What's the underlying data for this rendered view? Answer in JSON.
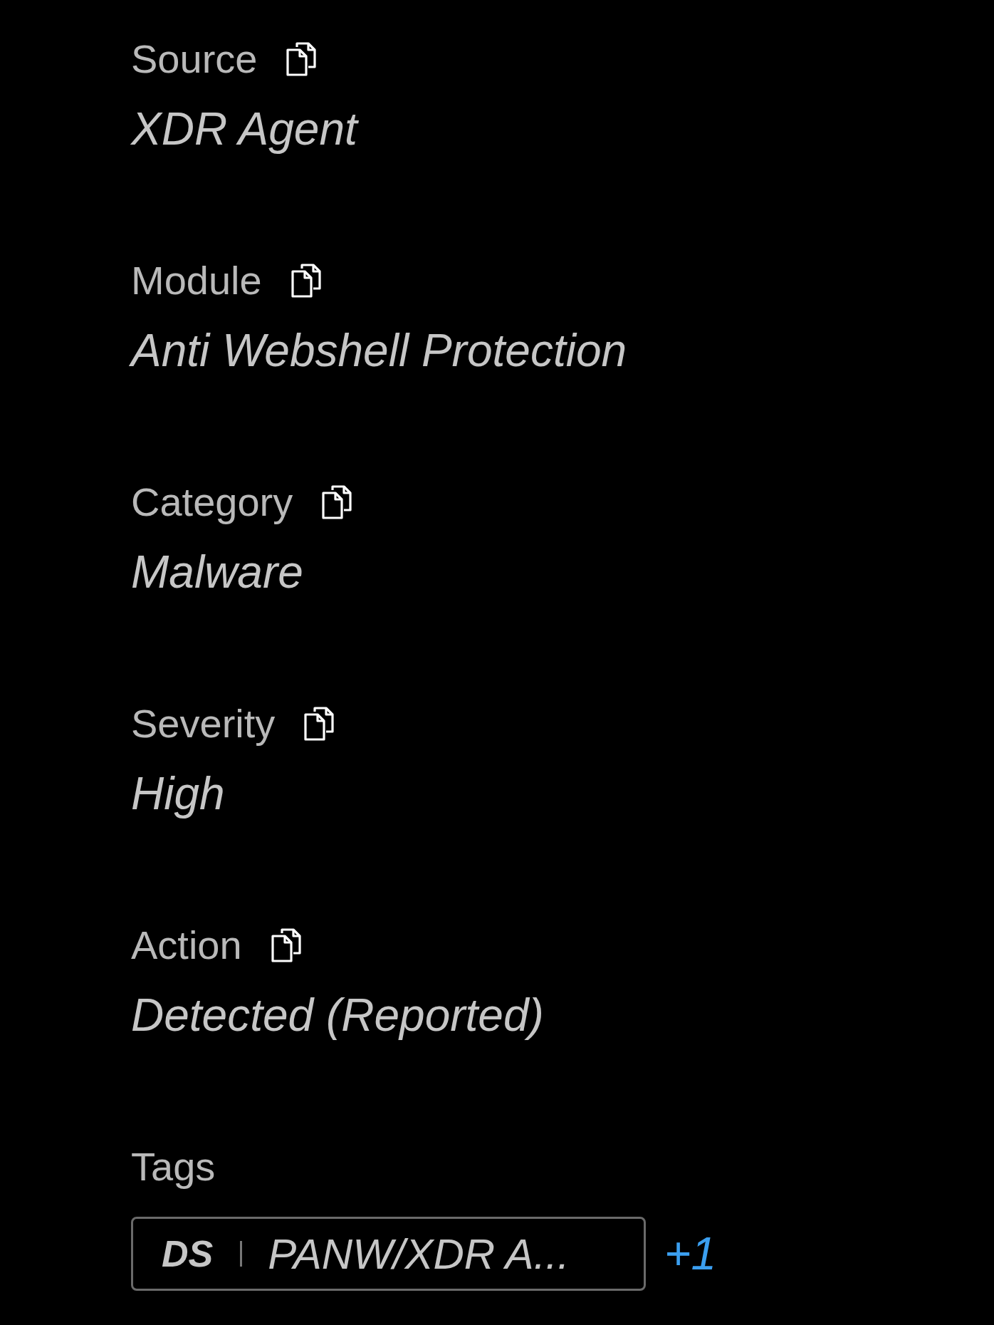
{
  "fields": [
    {
      "label": "Source",
      "value": "XDR Agent"
    },
    {
      "label": "Module",
      "value": "Anti Webshell Protection"
    },
    {
      "label": "Category",
      "value": "Malware"
    },
    {
      "label": "Severity",
      "value": "High"
    },
    {
      "label": "Action",
      "value": "Detected (Reported)"
    }
  ],
  "tags": {
    "label": "Tags",
    "items": [
      {
        "prefix": "DS",
        "text": "PANW/XDR A..."
      }
    ],
    "more": "+1"
  }
}
